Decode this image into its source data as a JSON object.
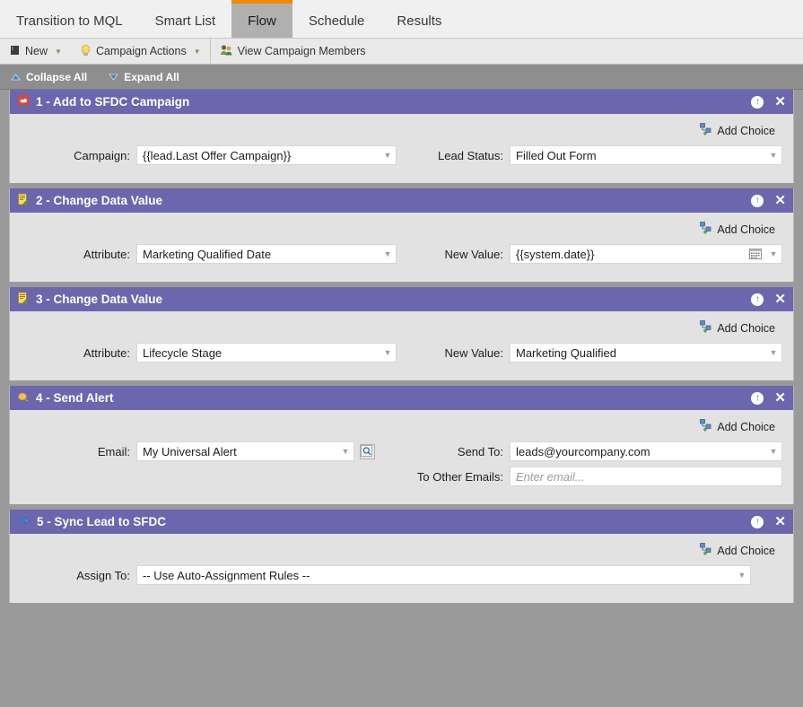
{
  "tabs": [
    {
      "label": "Transition to MQL",
      "active": false
    },
    {
      "label": "Smart List",
      "active": false
    },
    {
      "label": "Flow",
      "active": true
    },
    {
      "label": "Schedule",
      "active": false
    },
    {
      "label": "Results",
      "active": false
    }
  ],
  "toolbar": {
    "new_label": "New",
    "campaign_actions_label": "Campaign Actions",
    "view_members_label": "View Campaign Members"
  },
  "collapse_bar": {
    "collapse_all": "Collapse All",
    "expand_all": "Expand All"
  },
  "common": {
    "add_choice": "Add Choice"
  },
  "colors": {
    "panel_header": "#6c66ae",
    "accent_tab": "#f28a00",
    "canvas": "#9a9a9a",
    "panel_body": "#e2e2e2"
  },
  "steps": [
    {
      "number": "1",
      "title": "1 - Add to SFDC Campaign",
      "icon": "salesforce-cloud-icon",
      "add_choice": "Add Choice",
      "left_fields": [
        {
          "label": "Campaign:",
          "value": "{{lead.Last Offer Campaign}}",
          "type": "select",
          "placeholder": ""
        }
      ],
      "right_fields": [
        {
          "label": "Lead Status:",
          "value": "Filled Out Form",
          "type": "select",
          "placeholder": ""
        }
      ]
    },
    {
      "number": "2",
      "title": "2 - Change Data Value",
      "icon": "edit-document-icon",
      "add_choice": "Add Choice",
      "left_fields": [
        {
          "label": "Attribute:",
          "value": "Marketing Qualified Date",
          "type": "select",
          "placeholder": ""
        }
      ],
      "right_fields": [
        {
          "label": "New Value:",
          "value": "{{system.date}}",
          "type": "select-calendar",
          "placeholder": ""
        }
      ]
    },
    {
      "number": "3",
      "title": "3 - Change Data Value",
      "icon": "edit-document-icon",
      "add_choice": "Add Choice",
      "left_fields": [
        {
          "label": "Attribute:",
          "value": "Lifecycle Stage",
          "type": "select",
          "placeholder": ""
        }
      ],
      "right_fields": [
        {
          "label": "New Value:",
          "value": "Marketing Qualified",
          "type": "select",
          "placeholder": ""
        }
      ]
    },
    {
      "number": "4",
      "title": "4 - Send Alert",
      "icon": "bell-alert-icon",
      "add_choice": "Add Choice",
      "left_fields": [
        {
          "label": "Email:",
          "value": "My Universal Alert",
          "type": "select-preview",
          "placeholder": ""
        }
      ],
      "right_fields": [
        {
          "label": "Send To:",
          "value": "leads@yourcompany.com",
          "type": "select",
          "placeholder": ""
        },
        {
          "label": "To Other Emails:",
          "value": "",
          "type": "text",
          "placeholder": "Enter email..."
        }
      ]
    },
    {
      "number": "5",
      "title": "5 - Sync Lead to SFDC",
      "icon": "blue-arrow-icon",
      "add_choice": "Add Choice",
      "left_fields": [
        {
          "label": "Assign To:",
          "value": "-- Use Auto-Assignment Rules --",
          "type": "select-wide",
          "placeholder": ""
        }
      ],
      "right_fields": []
    }
  ]
}
